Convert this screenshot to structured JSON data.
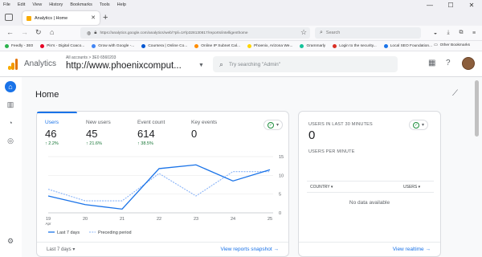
{
  "browser": {
    "menu": [
      "File",
      "Edit",
      "View",
      "History",
      "Bookmarks",
      "Tools",
      "Help"
    ],
    "tab_title": "Analytics | Home",
    "url": "https://analytics.google.com/analytics/web/?pli=1#/p328130817/reports/intelligenthome",
    "search_placeholder": "Search",
    "bookmarks": [
      {
        "label": "Feedly - 3E0",
        "color": "#2bb24c"
      },
      {
        "label": "Pin's - Digital Coaco...",
        "color": "#e60023"
      },
      {
        "label": "Grow with Google -...",
        "color": "#4285f4"
      },
      {
        "label": "Coursera | Online Co...",
        "color": "#0056d2"
      },
      {
        "label": "Online IP Subnet Cal...",
        "color": "#ff8c00"
      },
      {
        "label": "Phoenix, Arizona We...",
        "color": "#ffd500"
      },
      {
        "label": "Grammarly",
        "color": "#15c39a"
      },
      {
        "label": "Login to the security...",
        "color": "#d93025"
      },
      {
        "label": "Local SEO Foundation...",
        "color": "#1a73e8"
      }
    ],
    "other_bookmarks": "Other Bookmarks"
  },
  "header": {
    "app_title": "Analytics",
    "account_path": "All accounts > 3E0 6560203",
    "property_name": "http://www.phoenixcomput...",
    "search_placeholder": "Try searching \"Admin\""
  },
  "page": {
    "title": "Home"
  },
  "metrics": [
    {
      "label": "Users",
      "value": "46",
      "delta": "↑ 2.2%"
    },
    {
      "label": "New users",
      "value": "45",
      "delta": "↑ 21.6%"
    },
    {
      "label": "Event count",
      "value": "614",
      "delta": "↑ 38.5%"
    },
    {
      "label": "Key events",
      "value": "0",
      "delta": ""
    }
  ],
  "chart_data": {
    "type": "line",
    "x": [
      "19",
      "20",
      "21",
      "22",
      "23",
      "24",
      "25"
    ],
    "x_sublabel": "Apr",
    "ylim": [
      0,
      15
    ],
    "yticks": [
      "0",
      "5",
      "10",
      "15"
    ],
    "series": [
      {
        "name": "Last 7 days",
        "values": [
          4.5,
          2.2,
          1.0,
          11.8,
          12.8,
          8.5,
          11.5
        ],
        "color": "#1a73e8"
      },
      {
        "name": "Preceding period",
        "values": [
          6.3,
          3.2,
          3.2,
          10.5,
          4.5,
          11.0,
          11.0
        ],
        "color": "#8ab4f8"
      }
    ]
  },
  "main_card": {
    "date_range": "Last 7 days",
    "footer_link": "View reports snapshot"
  },
  "realtime": {
    "title": "USERS IN LAST 30 MINUTES",
    "value": "0",
    "per_minute": "USERS PER MINUTE",
    "col_country": "COUNTRY",
    "col_users": "USERS",
    "empty": "No data available",
    "footer_link": "View realtime"
  }
}
